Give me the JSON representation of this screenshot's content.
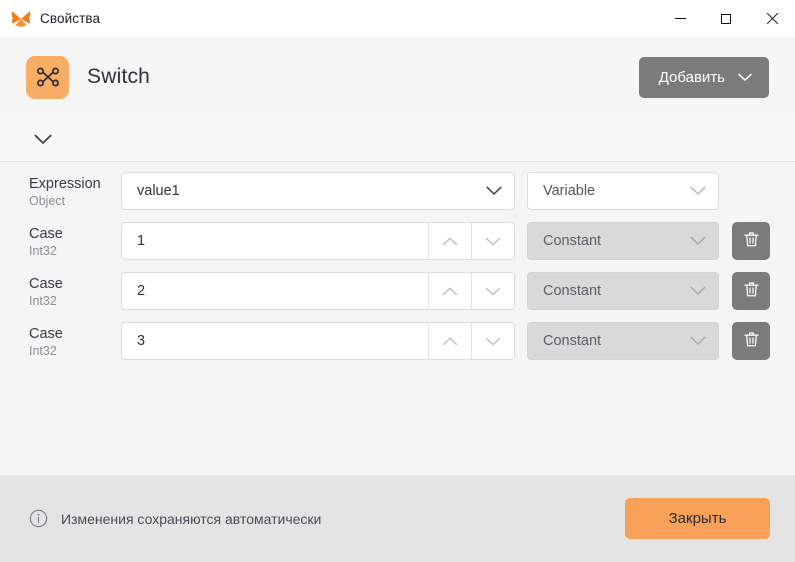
{
  "window": {
    "title": "Свойства",
    "app_icon": "butterfly-icon",
    "controls": {
      "minimize": "minimize-icon",
      "maximize": "maximize-icon",
      "close": "close-icon"
    }
  },
  "header": {
    "node_icon": "switch-node-icon",
    "node_title": "Switch",
    "add_button": {
      "label": "Добавить",
      "chevron": "chevron-down-icon",
      "color": "#7b7b7b"
    }
  },
  "collapse": {
    "chevron": "chevron-down-icon"
  },
  "rows": [
    {
      "label": "Expression",
      "type_label": "Object",
      "field_kind": "combo",
      "value": "value1",
      "selector": "Variable",
      "selector_muted": false,
      "deletable": false
    },
    {
      "label": "Case",
      "type_label": "Int32",
      "field_kind": "number",
      "value": "1",
      "selector": "Constant",
      "selector_muted": true,
      "deletable": true
    },
    {
      "label": "Case",
      "type_label": "Int32",
      "field_kind": "number",
      "value": "2",
      "selector": "Constant",
      "selector_muted": true,
      "deletable": true
    },
    {
      "label": "Case",
      "type_label": "Int32",
      "field_kind": "number",
      "value": "3",
      "selector": "Constant",
      "selector_muted": true,
      "deletable": true
    }
  ],
  "footer": {
    "info_icon": "info-circle-icon",
    "note": "Изменения сохраняются автоматически",
    "close_label": "Закрыть",
    "close_color": "#f9a159"
  },
  "colors": {
    "accent_orange": "#f9a159",
    "node_icon_bg": "#f9ac63",
    "gray_button": "#7b7b7b",
    "content_bg": "#f5f5f5",
    "footer_bg": "#e4e4e4",
    "titlebar_bg": "#ffffff"
  }
}
